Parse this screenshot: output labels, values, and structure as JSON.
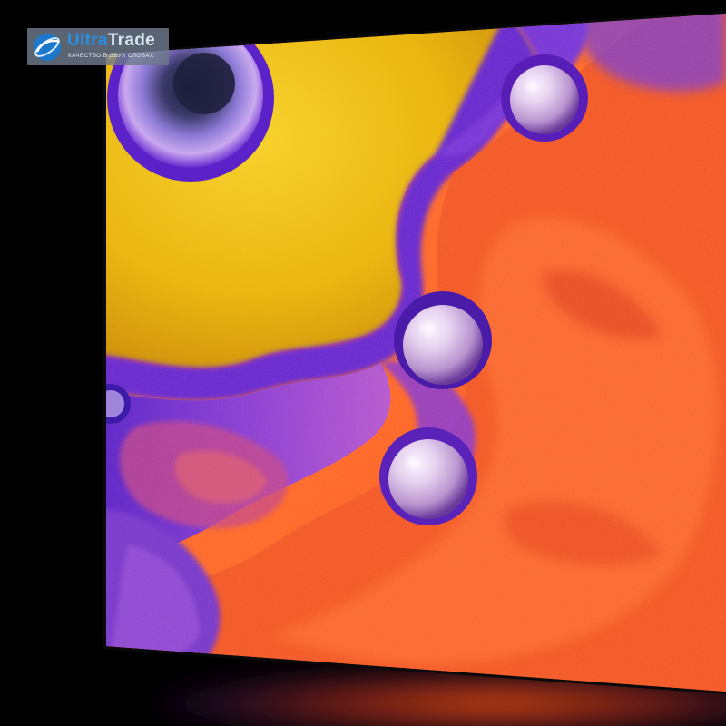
{
  "watermark": {
    "brand_part1": "Ultra",
    "brand_part2": "Trade",
    "tagline": "Качество в двух словах"
  },
  "colors": {
    "background": "#000000",
    "gold": "#e8b40c",
    "orange": "#f2602a",
    "violet": "#6a2bd0",
    "purple": "#9b4fd8",
    "pearl": "#d9c8e8",
    "logo_blue": "#2a8fe0",
    "logo_panel": "#6e7a8c"
  }
}
